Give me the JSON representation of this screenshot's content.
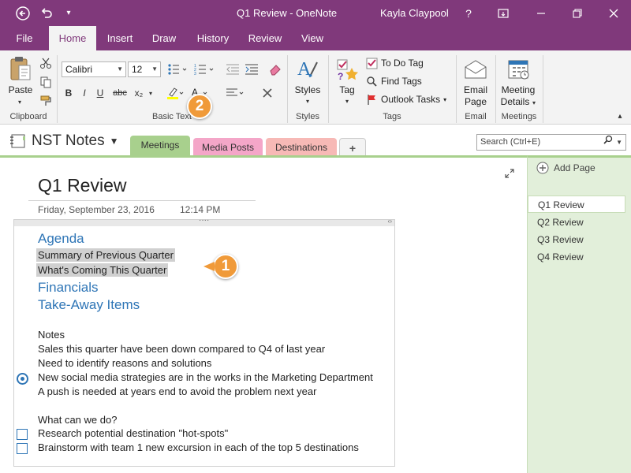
{
  "window": {
    "title": "Q1 Review - OneNote",
    "user": "Kayla Claypool",
    "help": "?"
  },
  "menu": {
    "tabs": [
      "File",
      "Home",
      "Insert",
      "Draw",
      "History",
      "Review",
      "View"
    ],
    "active": "Home"
  },
  "ribbon": {
    "clipboard": {
      "paste": "Paste",
      "label": "Clipboard"
    },
    "basic_text": {
      "font": "Calibri",
      "size": "12",
      "label": "Basic Text",
      "bold": "B",
      "italic": "I",
      "underline": "U",
      "strike": "abc",
      "sub": "x₂"
    },
    "styles": {
      "button": "Styles",
      "label": "Styles"
    },
    "tags": {
      "tag": "Tag",
      "todo": "To Do Tag",
      "find": "Find Tags",
      "outlook": "Outlook Tasks",
      "label": "Tags"
    },
    "email": {
      "button_line1": "Email",
      "button_line2": "Page",
      "label": "Email"
    },
    "meetings": {
      "button_line1": "Meeting",
      "button_line2": "Details",
      "label": "Meetings"
    }
  },
  "notebook": {
    "name": "NST Notes",
    "sections": [
      {
        "label": "Meetings",
        "color": "#a8d08d"
      },
      {
        "label": "Media Posts",
        "color": "#f4a6c8"
      },
      {
        "label": "Destinations",
        "color": "#f7b9b6"
      },
      {
        "label": "+",
        "color": "#f3f3f3"
      }
    ],
    "search_placeholder": "Search (Ctrl+E)"
  },
  "page": {
    "title": "Q1 Review",
    "date": "Friday, September 23, 2016",
    "time": "12:14 PM",
    "agenda": {
      "heading": "Agenda",
      "selected_lines": [
        "Summary of Previous Quarter",
        "What's Coming This Quarter"
      ],
      "headings": [
        "Financials",
        "Take-Away Items"
      ]
    },
    "notes": {
      "label": "Notes",
      "lines": [
        "Sales this quarter have been down compared to Q4 of last year",
        "Need to identify reasons and solutions",
        "New social media strategies are in the works in the Marketing Department",
        "A push is needed at years end to avoid the problem next year"
      ]
    },
    "todo": {
      "label": "What can we do?",
      "items": [
        "Research potential destination \"hot-spots\"",
        "Brainstorm with team 1 new excursion in each of the top 5 destinations"
      ]
    }
  },
  "pages_panel": {
    "add": "Add Page",
    "items": [
      "Q1 Review",
      "Q2 Review",
      "Q3 Review",
      "Q4 Review"
    ],
    "active": "Q1 Review"
  },
  "callouts": [
    "1",
    "2"
  ]
}
